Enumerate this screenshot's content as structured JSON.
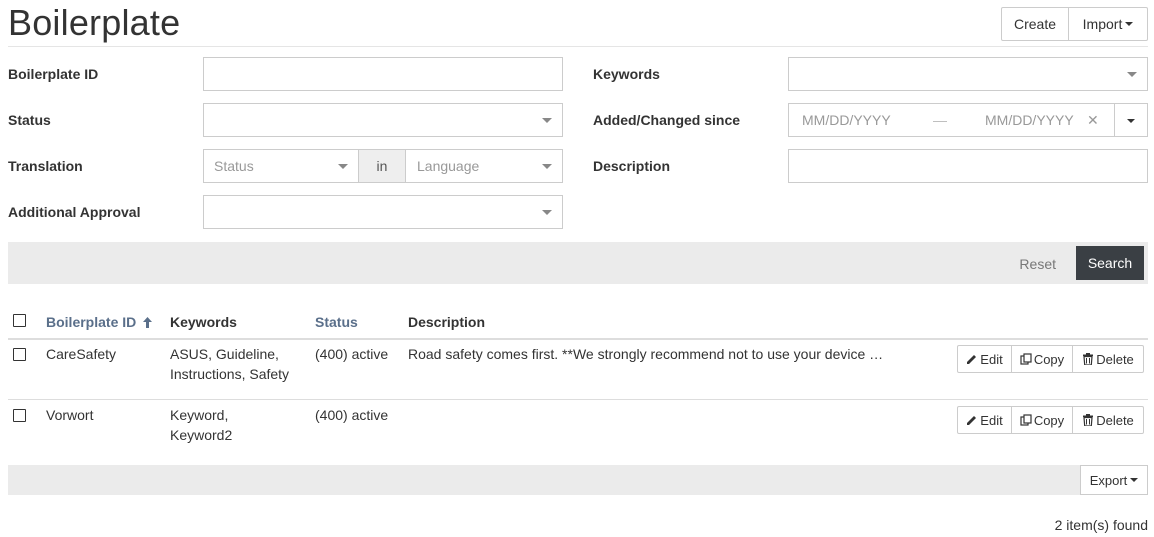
{
  "page": {
    "title": "Boilerplate"
  },
  "toolbar": {
    "create_label": "Create",
    "import_label": "Import"
  },
  "filters": {
    "boilerplate_id": {
      "label": "Boilerplate ID",
      "value": ""
    },
    "keywords": {
      "label": "Keywords",
      "value": ""
    },
    "status": {
      "label": "Status",
      "value": ""
    },
    "added_changed_since": {
      "label": "Added/Changed since",
      "from_placeholder": "MM/DD/YYYY",
      "separator": "—",
      "to_placeholder": "MM/DD/YYYY",
      "clear_glyph": "✕"
    },
    "translation": {
      "label": "Translation",
      "status_placeholder": "Status",
      "in_label": "in",
      "language_placeholder": "Language"
    },
    "description": {
      "label": "Description",
      "value": ""
    },
    "additional_approval": {
      "label": "Additional Approval",
      "value": ""
    }
  },
  "actions": {
    "reset_label": "Reset",
    "search_label": "Search"
  },
  "table": {
    "columns": [
      "Boilerplate ID",
      "Keywords",
      "Status",
      "Description"
    ],
    "sort_indicator": "🠕",
    "rows": [
      {
        "id": "CareSafety",
        "keywords_line1": "ASUS, Guideline,",
        "keywords_line2": "Instructions, Safety",
        "status": "(400) active",
        "description": "Road safety comes first. **We strongly recommend not to use your device …"
      },
      {
        "id": "Vorwort",
        "keywords_line1": "Keyword,",
        "keywords_line2": "Keyword2",
        "status": "(400) active",
        "description": ""
      }
    ],
    "row_actions": {
      "edit": "Edit",
      "copy": "Copy",
      "delete": "Delete"
    }
  },
  "footer": {
    "export_label": "Export",
    "count_text": "2 item(s) found"
  }
}
